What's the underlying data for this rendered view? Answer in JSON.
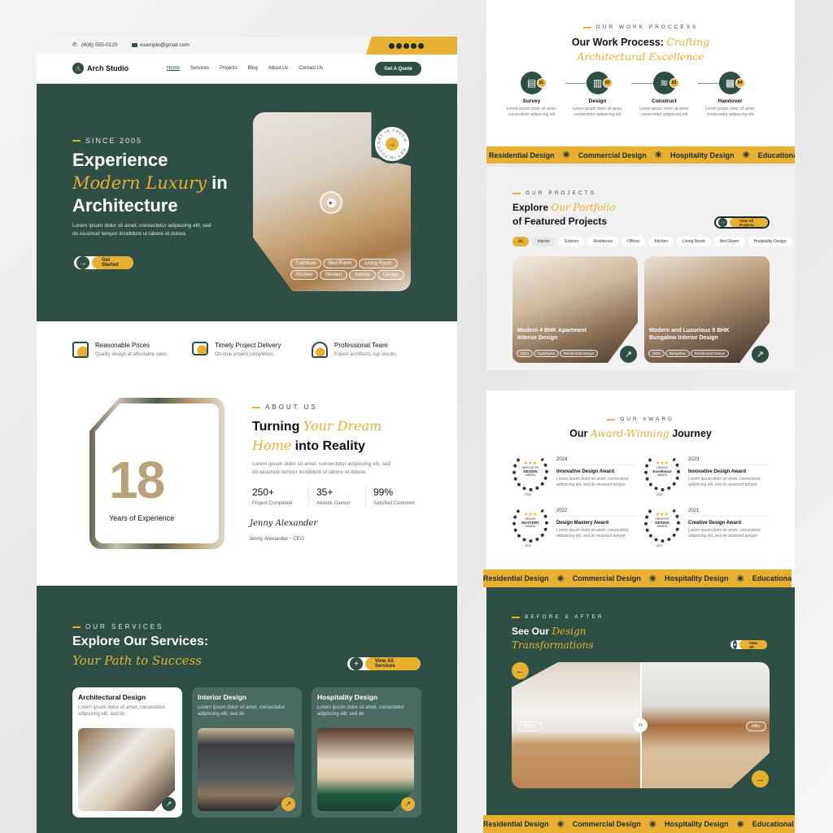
{
  "colors": {
    "green": "#2d4f46",
    "yellow": "#e8b030"
  },
  "topbar": {
    "phone": "(406) 555-0120",
    "email": "example@gmail.com",
    "social_icons": [
      "facebook-icon",
      "twitter-icon",
      "pinterest-icon",
      "instagram-icon",
      "youtube-icon"
    ]
  },
  "nav": {
    "logo_letter": "A",
    "brand": "Arch Studio",
    "items": [
      "Home",
      "Services",
      "Projects",
      "Blog",
      "About Us",
      "Contact Us"
    ],
    "active": "Home",
    "cta": "Get A Quote"
  },
  "hero": {
    "eyebrow": "SINCE 2005",
    "title_1": "Experience",
    "title_accent": "Modern Luxury",
    "title_2": " in",
    "title_3": "Architecture",
    "description": "Lorem ipsum dolor sit amet, consectetur adipiscing elit, sed do eiusmod tempor incididunt ut labore et dolore.",
    "cta": "Get Started",
    "badge_text": "GET IN TOUCH · GET IN TOUCH ·",
    "tags": [
      "Furniture",
      "Bed Room",
      "Living Room",
      "Kitchen",
      "Modern",
      "Interior",
      "Design"
    ]
  },
  "features": [
    {
      "icon": "box-icon",
      "title": "Reasonable Prices",
      "desc": "Quality design at affordable rates."
    },
    {
      "icon": "wallet-icon",
      "title": "Timely Project Delivery",
      "desc": "On-time project completion."
    },
    {
      "icon": "team-icon",
      "title": "Professional Team",
      "desc": "Expert architects, top results."
    }
  ],
  "about": {
    "number": "18",
    "years_label": "Years of Experience",
    "eyebrow": "ABOUT US",
    "title_1": "Turning ",
    "title_accent_1": "Your Dream",
    "title_accent_2": "Home",
    "title_2": " into Reality",
    "description": "Lorem ipsum dolor sit amet, consectetur adipiscing elit, sed do eiusmod tempor incididunt ut labore et dolore.",
    "stats": [
      {
        "value": "250+",
        "label": "Project Completed"
      },
      {
        "value": "35+",
        "label": "Awards Gained"
      },
      {
        "value": "99%",
        "label": "Satisfied Customer"
      }
    ],
    "signature": "Jenny Alexander",
    "author": "Jenny Alexander",
    "role": "CEO"
  },
  "services": {
    "eyebrow": "OUR SERVICES",
    "title": "Explore Our Services:",
    "title_accent": "Your Path to Success",
    "cta": "View All Services",
    "cards": [
      {
        "title": "Architectural Design",
        "desc": "Lorem ipsum dolor sit amet, consectetur adipiscing elit, sed do"
      },
      {
        "title": "Interior Design",
        "desc": "Lorem ipsum dolor sit amet, consectetur adipiscing elit, sed do"
      },
      {
        "title": "Hospitality Design",
        "desc": "Lorem ipsum dolor sit amet, consectetur adipiscing elit, sed do"
      }
    ]
  },
  "process": {
    "eyebrow": "OUR WORK PROCCESS",
    "title": "Our Work Process: ",
    "title_accent_1": "Crafting",
    "title_accent_2": "Architectural Excellence",
    "steps": [
      {
        "num": "01",
        "icon": "clipboard-icon",
        "title": "Survey",
        "desc": "Lorem ipsum dolor sit amet, consectetur adipiscing elit"
      },
      {
        "num": "02",
        "icon": "ruler-icon",
        "title": "Design",
        "desc": "Lorem ipsum dolor sit amet, consectetur adipiscing elit"
      },
      {
        "num": "03",
        "icon": "layers-icon",
        "title": "Construct",
        "desc": "Lorem ipsum dolor sit amet, consectetur adipiscing elit"
      },
      {
        "num": "04",
        "icon": "building-icon",
        "title": "Handover",
        "desc": "Lorem ipsum dolor sit amet, consectetur adipiscing elit"
      }
    ]
  },
  "marquee": [
    "Residential Design",
    "Commercial Design",
    "Hospitality Design",
    "Educational Architecture"
  ],
  "projects": {
    "eyebrow": "OUR PROJECTS",
    "title_1": "Explore ",
    "title_accent": "Our Portfolio",
    "title_2": "of Featured Projects",
    "cta": "View All Projects",
    "filters": [
      "All",
      "Interior",
      "Exterior",
      "Residence",
      "Offices",
      "Kitchen",
      "Living Room",
      "Bed Room",
      "Hospitality Design",
      "Ed"
    ],
    "active_filter": "All",
    "cards": [
      {
        "title": "Modern 4 BHK Apartment Interior Design",
        "tags": [
          "2024",
          "Apartment",
          "Residential Design"
        ]
      },
      {
        "title": "Modern and Luxurious  6 BHK Bungalow Interior Design",
        "tags": [
          "2024",
          "Bungalow",
          "Residential Design"
        ]
      }
    ]
  },
  "awards": {
    "eyebrow": "OUR AWARD",
    "title_1": "Our ",
    "title_accent": "Award-Winning",
    "title_2": " Journey",
    "items": [
      {
        "year": "2024",
        "title": "Innovative Design Award",
        "desc": "Lorem ipsum dolor sit amet, consectetur adipiscing elit, sed do eiusmod tempor",
        "badge_top": "INNOVATIVE",
        "badge_main": "DESIGN",
        "badge_bottom": "AWARD"
      },
      {
        "year": "2023",
        "title": "Innovative Design Award",
        "desc": "Lorem ipsum dolor sit amet, consectetur adipiscing elit, sed do eiusmod tempor",
        "badge_top": "DESIGN",
        "badge_main": "Excellence",
        "badge_bottom": "AWARD"
      },
      {
        "year": "2022",
        "title": "Design Mastery Award",
        "desc": "Lorem ipsum dolor sit amet, consectetur adipiscing elit, sed do eiusmod tempor",
        "badge_top": "DESIGN",
        "badge_main": "MASTERY",
        "badge_bottom": "AWARD"
      },
      {
        "year": "2021",
        "title": "Creative Design Award",
        "desc": "Lorem ipsum dolor sit amet, consectetur adipiscing elit, sed do eiusmod tempor",
        "badge_top": "CREATIVE",
        "badge_main": "DESIGN",
        "badge_bottom": "AWARD"
      }
    ]
  },
  "before_after": {
    "eyebrow": "BEFORE & AFTER",
    "title_1": "See Our ",
    "title_accent_1": "Design",
    "title_accent_2": "Transformations",
    "cta": "View All",
    "before_label": "Before",
    "after_label": "After"
  }
}
